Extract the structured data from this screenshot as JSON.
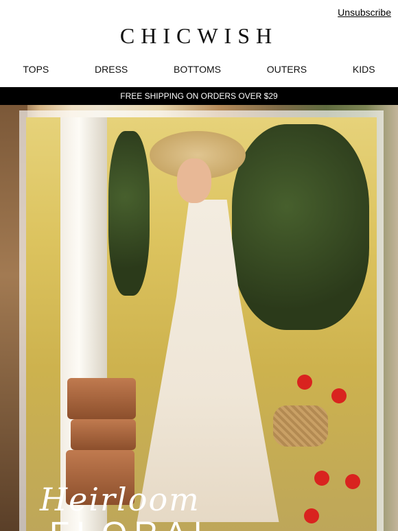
{
  "header": {
    "unsubscribe": "Unsubscribe",
    "brand": "CHICWISH",
    "nav": [
      "TOPS",
      "DRESS",
      "BOTTOMS",
      "OUTERS",
      "KIDS"
    ]
  },
  "promo": {
    "text": "FREE SHIPPING ON ORDERS OVER $29"
  },
  "hero": {
    "script": "Heirloom",
    "headline": "FLORAL"
  },
  "colors": {
    "promo_bar": "#000000",
    "accent_red": "#d9231f"
  }
}
